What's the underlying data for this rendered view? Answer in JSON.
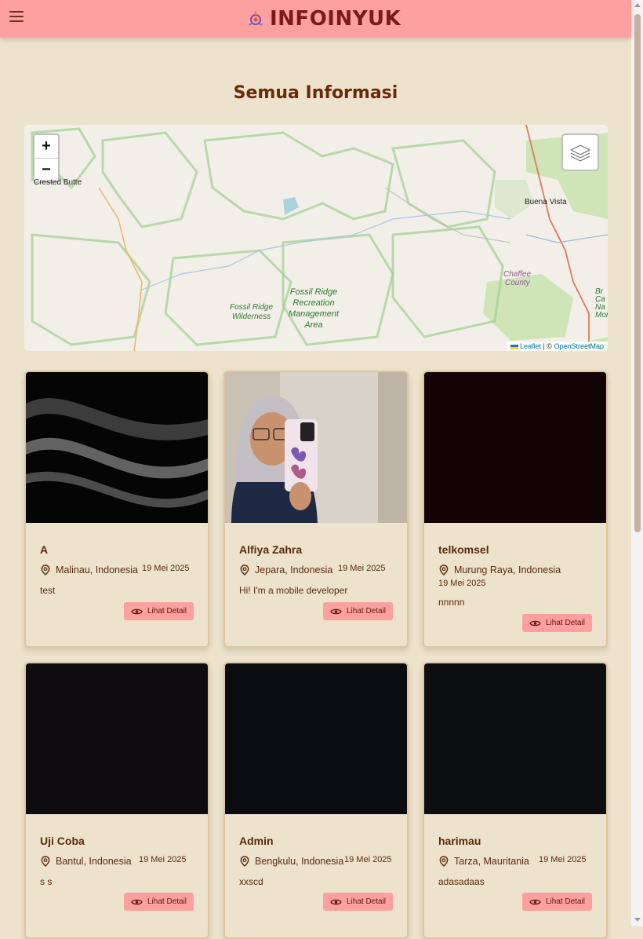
{
  "header": {
    "brand": "INFOINYUK"
  },
  "page": {
    "title": "Semua Informasi"
  },
  "map": {
    "zoom_in": "+",
    "zoom_out": "−",
    "labels": {
      "crested_butte": "Crested Butte",
      "buena_vista": "Buena Vista",
      "chaffee_1": "Chaffee",
      "chaffee_2": "County",
      "fossil_ridge_wilderness_1": "Fossil Ridge",
      "fossil_ridge_wilderness_2": "Wilderness",
      "fossil_ridge_rec_1": "Fossil Ridge",
      "fossil_ridge_rec_2": "Recreation",
      "fossil_ridge_rec_3": "Management",
      "fossil_ridge_rec_4": "Area",
      "edge_1": "Br",
      "edge_2": "Ca",
      "edge_3": "Na",
      "edge_4": "Mor"
    },
    "attribution": {
      "leaflet": "Leaflet",
      "separator": " | © ",
      "osm": "OpenStreetMap"
    }
  },
  "cards": [
    {
      "name": "A",
      "location": "Malinau, Indonesia",
      "date": "19 Mei 2025",
      "description": "test",
      "button": "Lihat Detail"
    },
    {
      "name": "Alfiya Zahra",
      "location": "Jepara, Indonesia",
      "date": "19 Mei 2025",
      "description": "Hi! I'm a mobile developer",
      "button": "Lihat Detail"
    },
    {
      "name": "telkomsel",
      "location": "Murung Raya, Indonesia",
      "date": "19 Mei 2025",
      "description": "nnnnn",
      "button": "Lihat Detail"
    },
    {
      "name": "Uji Coba",
      "location": "Bantul, Indonesia",
      "date": "19 Mei 2025",
      "description": "s s",
      "button": "Lihat Detail"
    },
    {
      "name": "Admin",
      "location": "Bengkulu, Indonesia",
      "date": "19 Mei 2025",
      "description": "xxscd",
      "button": "Lihat Detail"
    },
    {
      "name": "harimau",
      "location": "Tarza, Mauritania",
      "date": "19 Mei 2025",
      "description": "adasadaas",
      "button": "Lihat Detail"
    }
  ]
}
